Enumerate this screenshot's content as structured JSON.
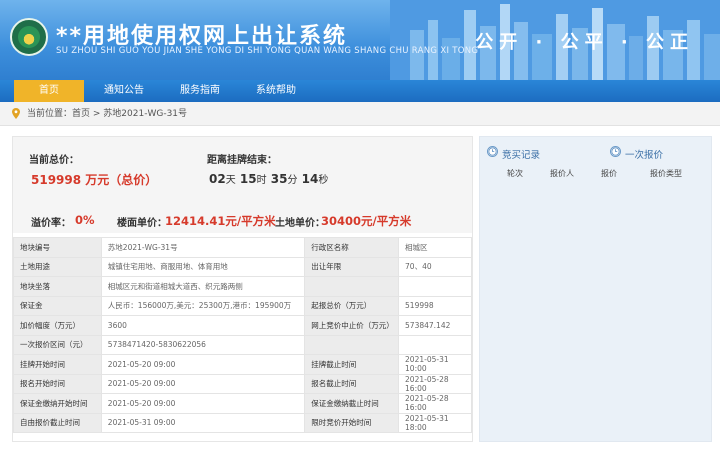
{
  "header": {
    "title": "**用地使用权网上出让系统",
    "pinyin": "SU ZHOU SHI GUO YOU JIAN SHE YONG DI SHI YONG QUAN WANG SHANG CHU RANG XI TONG",
    "right_text": "公开 · 公平 · 公正"
  },
  "nav": {
    "items": [
      "首页",
      "通知公告",
      "服务指南",
      "系统帮助"
    ],
    "active_index": 0,
    "active_color": "#f0b429"
  },
  "breadcrumb": {
    "prefix": "当前位置：",
    "home": "首页",
    "separator": " > ",
    "current": "苏地2021-WG-31号"
  },
  "price": {
    "current_total_label": "当前总价：",
    "current_total_value": "519998 万元（总价）",
    "countdown_label": "距离挂牌结束：",
    "countdown": {
      "days": "02",
      "days_unit": "天",
      "hours": "15",
      "hours_unit": "时",
      "minutes": "35",
      "minutes_unit": "分",
      "seconds": "14",
      "seconds_unit": "秒"
    },
    "premium_label": "溢价率：",
    "premium_value": "0%",
    "floor_price_label": "楼面单价：",
    "floor_price_value": "12414.41元/平方米",
    "land_price_label": "土地单价：",
    "land_price_value": "30400元/平方米",
    "highlight_color": "#d63a2b"
  },
  "info_rows": [
    {
      "k1": "地块编号",
      "v1": "苏地2021-WG-31号",
      "k2": "行政区名称",
      "v2": "相城区"
    },
    {
      "k1": "土地用途",
      "v1": "城镇住宅用地、商服用地、体育用地",
      "k2": "出让年限",
      "v2": "70、40"
    },
    {
      "k1": "地块坐落",
      "v1": "相城区元和街道相城大道西、织元路两侧",
      "k2": "",
      "v2": ""
    },
    {
      "k1": "保证金",
      "v1": "人民币：156000万,美元：25300万,港币：195900万",
      "k2": "起报总价（万元）",
      "v2": "519998"
    },
    {
      "k1": "加价幅度（万元）",
      "v1": "3600",
      "k2": "网上竞价中止价（万元）",
      "v2": "573847.142"
    },
    {
      "k1": "一次报价区间（元）",
      "v1": "5738471420-5830622056",
      "k2": "",
      "v2": ""
    },
    {
      "k1": "挂牌开始时间",
      "v1": "2021-05-20 09:00",
      "k2": "挂牌截止时间",
      "v2": "2021-05-31 10:00"
    },
    {
      "k1": "报名开始时间",
      "v1": "2021-05-20 09:00",
      "k2": "报名截止时间",
      "v2": "2021-05-28 16:00"
    },
    {
      "k1": "保证金缴纳开始时间",
      "v1": "2021-05-20 09:00",
      "k2": "保证金缴纳截止时间",
      "v2": "2021-05-28 16:00"
    },
    {
      "k1": "自由报价截止时间",
      "v1": "2021-05-31 09:00",
      "k2": "限时竞价开始时间",
      "v2": "2021-05-31 18:00"
    }
  ],
  "side": {
    "tab_records": "竞买记录",
    "tab_once": "一次报价",
    "columns": [
      "轮次",
      "报价人",
      "报价",
      "报价类型"
    ],
    "icon_records": "clock-icon",
    "icon_once": "clock-icon"
  }
}
